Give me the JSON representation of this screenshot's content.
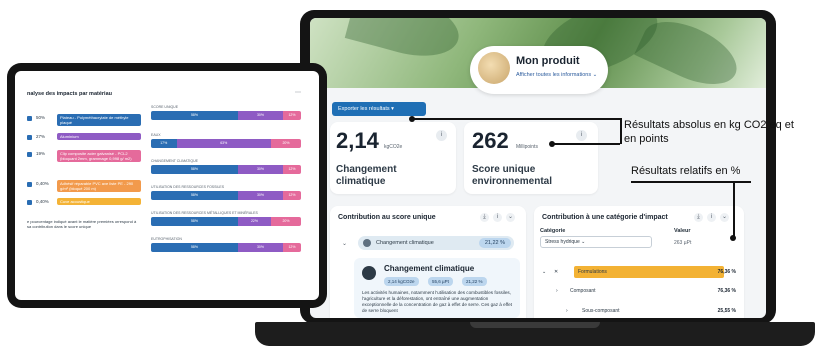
{
  "laptop": {
    "product": {
      "name": "Mon produit",
      "link": "Afficher toutes les informations ⌄"
    },
    "export_button": "Exporter les résultats ▾",
    "metric_climate": {
      "value": "2,14",
      "unit": "kgCO2e",
      "label": "Changement climatique"
    },
    "metric_score": {
      "value": "262",
      "unit": "Millipoints",
      "label": "Score unique environnemental"
    },
    "contribution_single": {
      "title": "Contribution au score unique",
      "row_label": "Changement climatique",
      "row_value": "21,22 %",
      "detail_title": "Changement climatique",
      "badges": [
        "2,14 kgCO2e",
        "55,6 µPt",
        "21,22 %"
      ],
      "detail_text": "Les activités humaines, notamment l'utilisation des combustibles fossiles, l'agriculture et la déforestation, ont entraîné une augmentation exceptionnelle de la concentration de gaz à effet de serre. Ces gaz à effet de serre bloquent"
    },
    "contribution_category": {
      "title": "Contribution à une catégorie d'impact",
      "category_label": "Catégorie",
      "category_value": "Stress hydrique ⌄",
      "value_label": "Valeur",
      "value_unit": "263 µPt",
      "rows": [
        {
          "label": "Formulations",
          "value": "76,36 %"
        },
        {
          "label": "Composant",
          "value": "76,36 %"
        },
        {
          "label": "Sous-composant",
          "value": "25,55 %"
        }
      ]
    }
  },
  "annotations": {
    "absolute": "Résultats absolus en kg CO2 éq et en points",
    "relative": "Résultats relatifs en %"
  },
  "tablet": {
    "title": "nalyse des impacts par matériau",
    "rows": [
      {
        "pct": "50%",
        "tag": "Plateau - Polyméthacrylate de méthyle plaqué",
        "color": "#2a6db3"
      },
      {
        "pct": "27%",
        "tag": "Aluminium",
        "color": "#8e5bc4"
      },
      {
        "pct": "19%",
        "tag": "Clip composite acier galvanisé - PCL2 (bloquant 2mm, grammage 0,998 g/ m2)",
        "color": "#e56a9b"
      },
      {
        "pct": "0,40%",
        "tag": "Adhésif réparable PVC ave liste PE - 290 g/m² (bloqué 200 m)",
        "color": "#f29a4c"
      },
      {
        "pct": "0,40%",
        "tag": "Cuve acoustique",
        "color": "#f4b336"
      }
    ],
    "note": "e pourcentage indiqué avant le matière premiées orrespond à sa contribution dans le score unique",
    "bars": [
      {
        "label": "SCORE UNIQUE",
        "segments": [
          {
            "value": 58,
            "color": "#2a6db3",
            "text": "58%"
          },
          {
            "value": 30,
            "color": "#8e5bc4",
            "text": "30%"
          },
          {
            "value": 12,
            "color": "#e56a9b",
            "text": "12%"
          }
        ]
      },
      {
        "label": "EAUX",
        "segments": [
          {
            "value": 17,
            "color": "#2a6db3",
            "text": "17%"
          },
          {
            "value": 63,
            "color": "#8e5bc4",
            "text": "63%"
          },
          {
            "value": 20,
            "color": "#e56a9b",
            "text": "20%"
          }
        ]
      },
      {
        "label": "CHANGEMENT CLIMATIQUE",
        "segments": [
          {
            "value": 58,
            "color": "#2a6db3",
            "text": "58%"
          },
          {
            "value": 30,
            "color": "#8e5bc4",
            "text": "30%"
          },
          {
            "value": 12,
            "color": "#e56a9b",
            "text": "12%"
          }
        ]
      },
      {
        "label": "UTILISATION DES RESSOURCES FOSSILES",
        "segments": [
          {
            "value": 58,
            "color": "#2a6db3",
            "text": "58%"
          },
          {
            "value": 30,
            "color": "#8e5bc4",
            "text": "30%"
          },
          {
            "value": 12,
            "color": "#e56a9b",
            "text": "12%"
          }
        ]
      },
      {
        "label": "UTILISATION DES RESSOURCES MÉTALLIQUES ET MINÉRALES",
        "segments": [
          {
            "value": 58,
            "color": "#2a6db3",
            "text": "58%"
          },
          {
            "value": 22,
            "color": "#8e5bc4",
            "text": "22%"
          },
          {
            "value": 20,
            "color": "#e56a9b",
            "text": "20%"
          }
        ]
      },
      {
        "label": "EUTROPHISATION",
        "segments": [
          {
            "value": 58,
            "color": "#2a6db3",
            "text": "58%"
          },
          {
            "value": 30,
            "color": "#8e5bc4",
            "text": "30%"
          },
          {
            "value": 12,
            "color": "#e56a9b",
            "text": "12%"
          }
        ]
      }
    ]
  }
}
